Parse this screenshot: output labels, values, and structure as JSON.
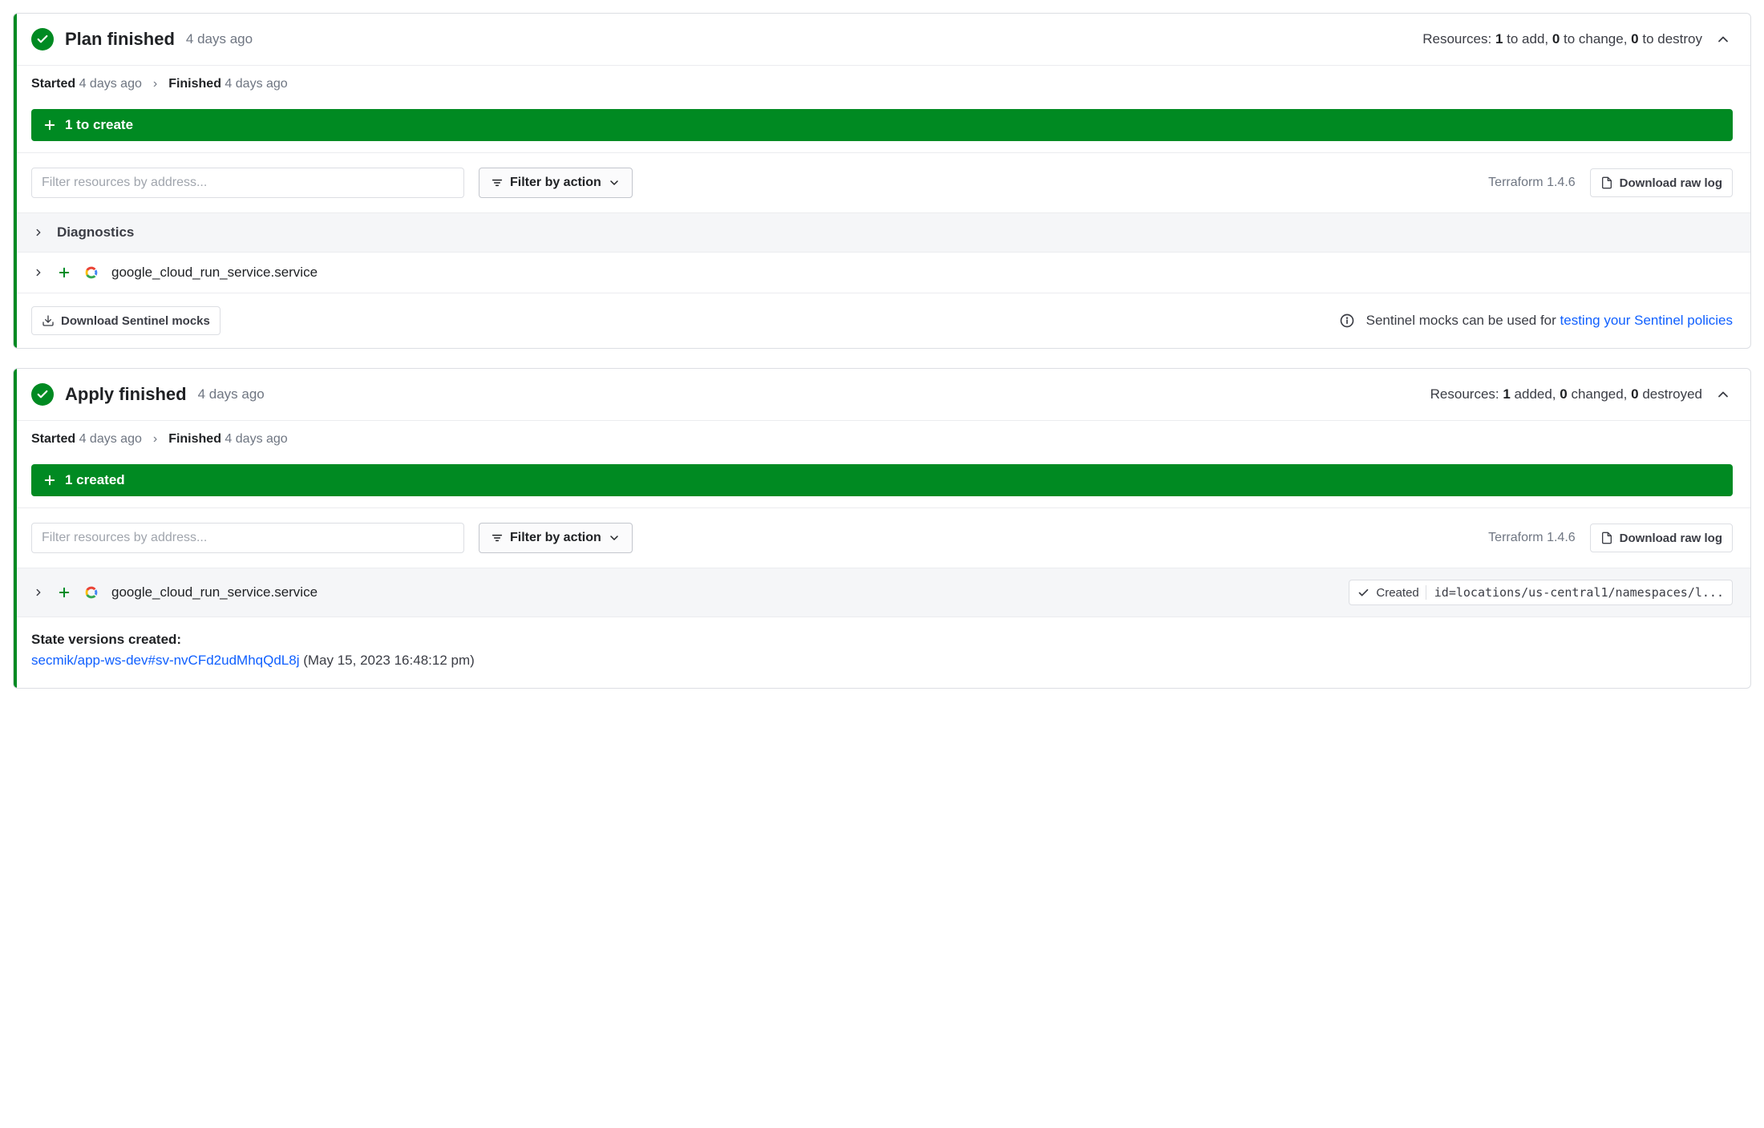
{
  "colors": {
    "accent": "#008a22",
    "link": "#1060ff"
  },
  "common": {
    "filter_placeholder": "Filter resources by address...",
    "filter_action_label": "Filter by action",
    "download_log_label": "Download raw log",
    "terraform_version": "Terraform 1.4.6"
  },
  "plan": {
    "title": "Plan finished",
    "ago": "4 days ago",
    "resources_prefix": "Resources: ",
    "add_n": "1",
    "add_suffix": " to add, ",
    "change_n": "0",
    "change_suffix": " to change, ",
    "destroy_n": "0",
    "destroy_suffix": " to destroy",
    "started_label": "Started",
    "started_ago": "4 days ago",
    "finished_label": "Finished",
    "finished_ago": "4 days ago",
    "banner": "1 to create",
    "diagnostics_label": "Diagnostics",
    "resource_name": "google_cloud_run_service.service",
    "sentinel_button": "Download Sentinel mocks",
    "sentinel_info_prefix": "Sentinel mocks can be used for ",
    "sentinel_link": "testing your Sentinel policies"
  },
  "apply": {
    "title": "Apply finished",
    "ago": "4 days ago",
    "resources_prefix": "Resources: ",
    "add_n": "1",
    "add_suffix": " added, ",
    "change_n": "0",
    "change_suffix": " changed, ",
    "destroy_n": "0",
    "destroy_suffix": " destroyed",
    "started_label": "Started",
    "started_ago": "4 days ago",
    "finished_label": "Finished",
    "finished_ago": "4 days ago",
    "banner": "1 created",
    "resource_name": "google_cloud_run_service.service",
    "status_chip_label": "Created",
    "resource_id": "id=locations/us-central1/namespaces/l...",
    "state_title": "State versions created:",
    "state_link": "secmik/app-ws-dev#sv-nvCFd2udMhqQdL8j",
    "state_meta": " (May 15, 2023 16:48:12 pm)"
  }
}
